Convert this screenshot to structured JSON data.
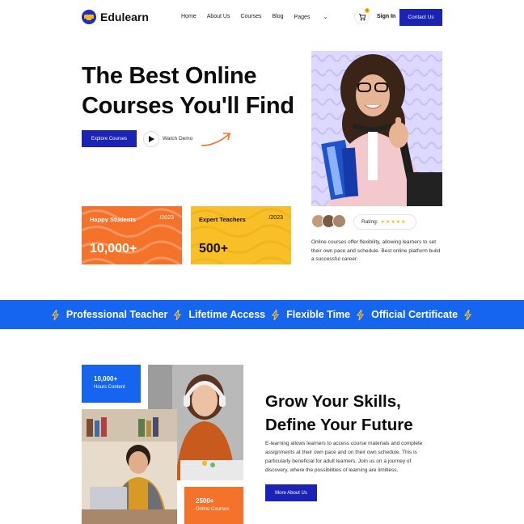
{
  "brand": {
    "name": "Edulearn",
    "accent": "#1a23b4",
    "blue": "#1565f1",
    "orange": "#f4722a",
    "yellow": "#f8bf27"
  },
  "nav": {
    "items": [
      "Home",
      "About Us",
      "Courses",
      "Blog",
      "Pages"
    ],
    "cart_count": "0",
    "signin": "Sign In",
    "contact": "Contact Us"
  },
  "hero": {
    "title_line1": "The Best Online",
    "title_line2": "Courses You'll Find",
    "explore": "Explore Courses",
    "watch": "Watch Demo",
    "rating_label": "Rating:",
    "stars": "★★★★★",
    "description": "Online courses offer flexibility, allowing learners to set their own pace and schedule. Best online platform build a successful career."
  },
  "stats": [
    {
      "label": "Happy Students",
      "year": "/2023",
      "value": "10,000+"
    },
    {
      "label": "Expert Teachers",
      "year": "/2023",
      "value": "500+"
    }
  ],
  "band": {
    "items": [
      "Professional Teacher",
      "Lifetime Access",
      "Flexible Time",
      "Official Certificate"
    ]
  },
  "about": {
    "hours_value": "10,000+",
    "hours_label": "Hours Content",
    "courses_value": "2500+",
    "courses_label": "Online Courses",
    "title_line1": "Grow Your Skills,",
    "title_line2": "Define Your Future",
    "description": "E-learning allows learners to access course materials and complete assignments at their own pace and on their own schedule. This is particularly beneficial for adult learners. Join us on a journey of discovery, where the possibilities of learning are limitless.",
    "more": "More About Us"
  }
}
